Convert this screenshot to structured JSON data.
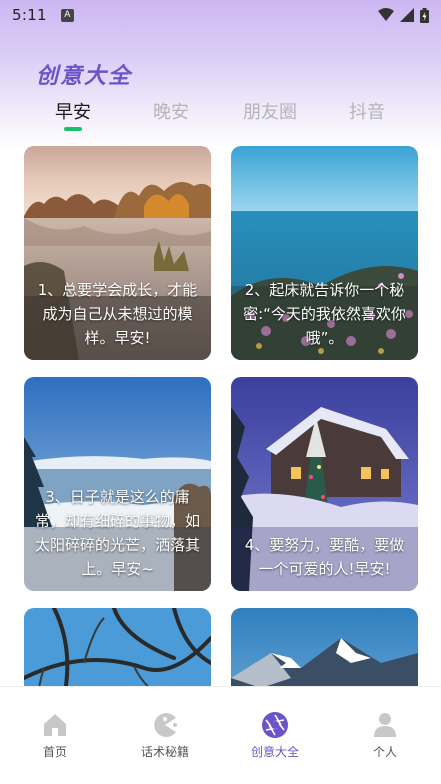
{
  "status_bar": {
    "time": "5:11",
    "notification_icon": "A",
    "icons": [
      "wifi-icon",
      "signal-icon",
      "battery-icon"
    ]
  },
  "header": {
    "title": "创意大全"
  },
  "tabs": [
    {
      "label": "早安",
      "active": true
    },
    {
      "label": "晚安",
      "active": false
    },
    {
      "label": "朋友圈",
      "active": false
    },
    {
      "label": "抖音",
      "active": false
    }
  ],
  "cards": [
    {
      "text": "1、总要学会成长，才能成为自己从未想过的模样。早安!"
    },
    {
      "text": "2、起床就告诉你一个秘密:“今天的我依然喜欢你哦”。"
    },
    {
      "text": "3、日子就是这么的庸常，却有细碎的事物，如太阳碎碎的光芒，洒落其上。早安~"
    },
    {
      "text": "4、要努力，要酷，要做一个可爱的人!早安!"
    }
  ],
  "bottom_nav": [
    {
      "label": "首页",
      "icon": "home-icon",
      "active": false
    },
    {
      "label": "话术秘籍",
      "icon": "pacman-icon",
      "active": false
    },
    {
      "label": "创意大全",
      "icon": "aperture-icon",
      "active": true
    },
    {
      "label": "个人",
      "icon": "person-icon",
      "active": false
    }
  ],
  "colors": {
    "accent": "#6b54c9",
    "tab_indicator": "#19c26a",
    "inactive_tab": "#b5b5b5"
  }
}
